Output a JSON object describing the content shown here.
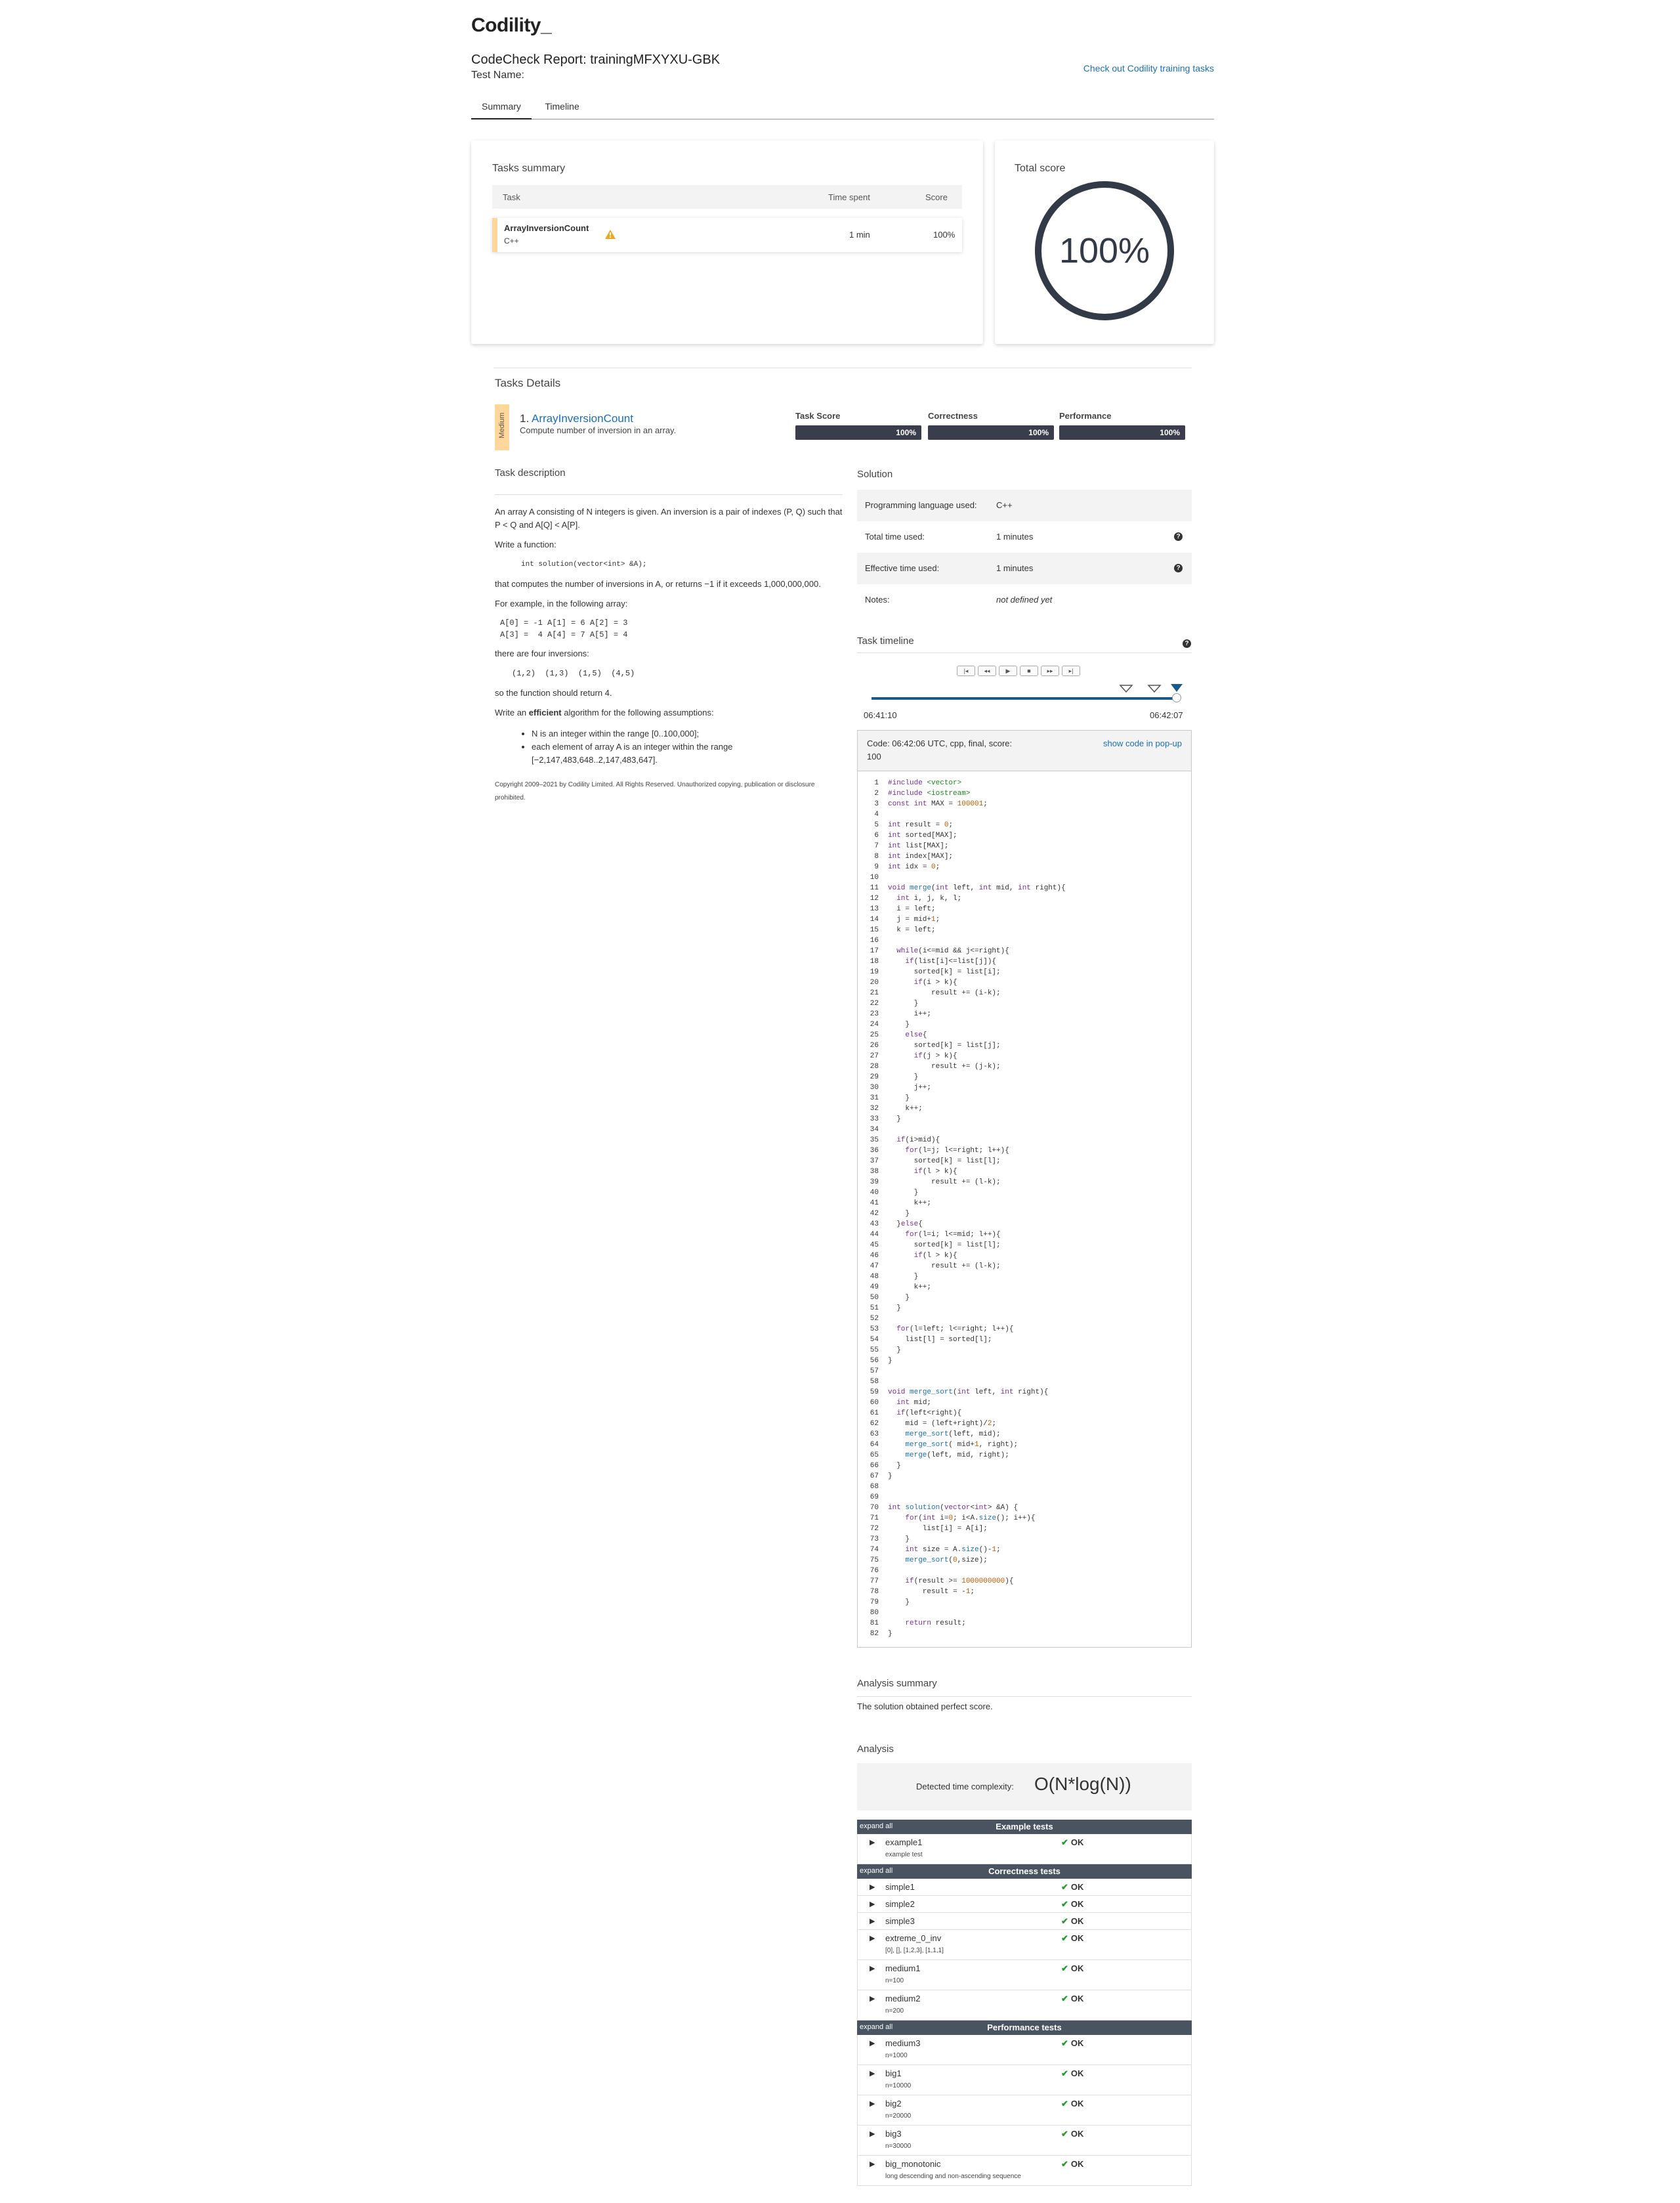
{
  "header": {
    "logo": "Codility_",
    "report_title": "CodeCheck Report: trainingMFXYXU-GBK",
    "test_name": "Test Name:",
    "training_link": "Check out Codility training tasks"
  },
  "tabs": [
    "Summary",
    "Timeline"
  ],
  "tasks_summary": {
    "title": "Tasks summary",
    "col_task": "Task",
    "col_time": "Time spent",
    "col_score": "Score",
    "task_name": "ArrayInversionCount",
    "task_lang": "C++",
    "time": "1 min",
    "score": "100%"
  },
  "total_score": {
    "title": "Total score",
    "value": "100%"
  },
  "tasks_details": {
    "title": "Tasks Details",
    "difficulty": "Medium",
    "num": "1.",
    "task_name": "ArrayInversionCount",
    "task_subtitle": "Compute number of inversion in an array.",
    "bars": [
      {
        "label": "Task Score",
        "value": "100%",
        "level": 1.0
      },
      {
        "label": "Correctness",
        "value": "100%",
        "level": 1.0
      },
      {
        "label": "Performance",
        "value": "100%",
        "level": 1.0
      }
    ]
  },
  "description": {
    "title": "Task description",
    "p1": "An array A consisting of N integers is given. An inversion is a pair of indexes (P, Q) such that P < Q and A[Q] < A[P].",
    "p2": "Write a function:",
    "sig": "int solution(vector<int> &A);",
    "p3": "that computes the number of inversions in A, or returns −1 if it exceeds 1,000,000,000.",
    "p4": "For example, in the following array:",
    "arr1": "A[0] = -1 A[1] = 6 A[2] = 3",
    "arr2": "A[3] =  4 A[4] = 7 A[5] = 4",
    "p5": "there are four inversions:",
    "inv": "(1,2)  (1,3)  (1,5)  (4,5)",
    "p6": "so the function should return 4.",
    "p7a": "Write an ",
    "p7b": "efficient",
    "p7c": " algorithm for the following assumptions:",
    "li1": "N is an integer within the range [0..100,000];",
    "li2": "each element of array A is an integer within the range [−2,147,483,648..2,147,483,647].",
    "copyright": "Copyright 2009–2021 by Codility Limited. All Rights Reserved. Unauthorized copying, publication or disclosure prohibited."
  },
  "solution": {
    "title": "Solution",
    "rows": [
      {
        "label": "Programming language used:",
        "value": "C++"
      },
      {
        "label": "Total time used:",
        "value": "1 minutes"
      },
      {
        "label": "Effective time used:",
        "value": "1 minutes"
      },
      {
        "label": "Notes:",
        "value": "not defined yet"
      }
    ]
  },
  "timeline": {
    "title": "Task timeline",
    "controls": [
      "|◂",
      "◂◂",
      "▶",
      "■",
      "▸▸",
      "▸|"
    ],
    "start": "06:41:10",
    "end": "06:42:07",
    "position": 1.0
  },
  "code_header": {
    "info": "Code: 06:42:06 UTC, cpp, final, score:",
    "score": "100",
    "popup": "show code in pop-up"
  },
  "code_lines": [
    "#include <vector>",
    "#include <iostream>",
    "const int MAX = 100001;",
    "",
    "int result = 0;",
    "int sorted[MAX];",
    "int list[MAX];",
    "int index[MAX];",
    "int idx = 0;",
    "",
    "void merge(int left, int mid, int right){",
    "  int i, j, k, l;",
    "  i = left;",
    "  j = mid+1;",
    "  k = left;",
    "",
    "  while(i<=mid && j<=right){",
    "    if(list[i]<=list[j]){",
    "      sorted[k] = list[i];",
    "      if(i > k){",
    "          result += (i-k);",
    "      }",
    "      i++;",
    "    }",
    "    else{",
    "      sorted[k] = list[j];",
    "      if(j > k){",
    "          result += (j-k);",
    "      }",
    "      j++;",
    "    }",
    "    k++;",
    "  }",
    "",
    "  if(i>mid){",
    "    for(l=j; l<=right; l++){",
    "      sorted[k] = list[l];",
    "      if(l > k){",
    "          result += (l-k);",
    "      }",
    "      k++;",
    "    }",
    "  }else{",
    "    for(l=i; l<=mid; l++){",
    "      sorted[k] = list[l];",
    "      if(l > k){",
    "          result += (l-k);",
    "      }",
    "      k++;",
    "    }",
    "  }",
    "",
    "  for(l=left; l<=right; l++){",
    "    list[l] = sorted[l];",
    "  }",
    "}",
    "",
    "",
    "void merge_sort(int left, int right){",
    "  int mid;",
    "  if(left<right){",
    "    mid = (left+right)/2;",
    "    merge_sort(left, mid);",
    "    merge_sort( mid+1, right);",
    "    merge(left, mid, right);",
    "  }",
    "}",
    "",
    "",
    "int solution(vector<int> &A) {",
    "    for(int i=0; i<A.size(); i++){",
    "        list[i] = A[i];",
    "    }",
    "    int size = A.size()-1;",
    "    merge_sort(0,size);",
    "",
    "    if(result >= 1000000000){",
    "        result = -1;",
    "    }",
    "",
    "    return result;",
    "}"
  ],
  "analysis_summary": {
    "title": "Analysis summary",
    "text": "The solution obtained perfect score."
  },
  "analysis": {
    "title": "Analysis",
    "complexity_label": "Detected time complexity:",
    "complexity": "O(N*log(N))",
    "expand_all": "expand all",
    "groups": [
      {
        "title": "Example tests",
        "tests": [
          {
            "name": "example1",
            "sub": "example test",
            "result": "OK"
          }
        ]
      },
      {
        "title": "Correctness tests",
        "tests": [
          {
            "name": "simple1",
            "sub": "",
            "result": "OK"
          },
          {
            "name": "simple2",
            "sub": "",
            "result": "OK"
          },
          {
            "name": "simple3",
            "sub": "",
            "result": "OK"
          },
          {
            "name": "extreme_0_inv",
            "sub": "[0], [], [1,2,3], [1,1,1]",
            "result": "OK"
          },
          {
            "name": "medium1",
            "sub": "n=100",
            "result": "OK"
          },
          {
            "name": "medium2",
            "sub": "n=200",
            "result": "OK"
          }
        ]
      },
      {
        "title": "Performance tests",
        "tests": [
          {
            "name": "medium3",
            "sub": "n=1000",
            "result": "OK"
          },
          {
            "name": "big1",
            "sub": "n=10000",
            "result": "OK"
          },
          {
            "name": "big2",
            "sub": "n=20000",
            "result": "OK"
          },
          {
            "name": "big3",
            "sub": "n=30000",
            "result": "OK"
          },
          {
            "name": "big_monotonic",
            "sub": "long descending and non-ascending sequence",
            "result": "OK"
          }
        ]
      }
    ]
  }
}
